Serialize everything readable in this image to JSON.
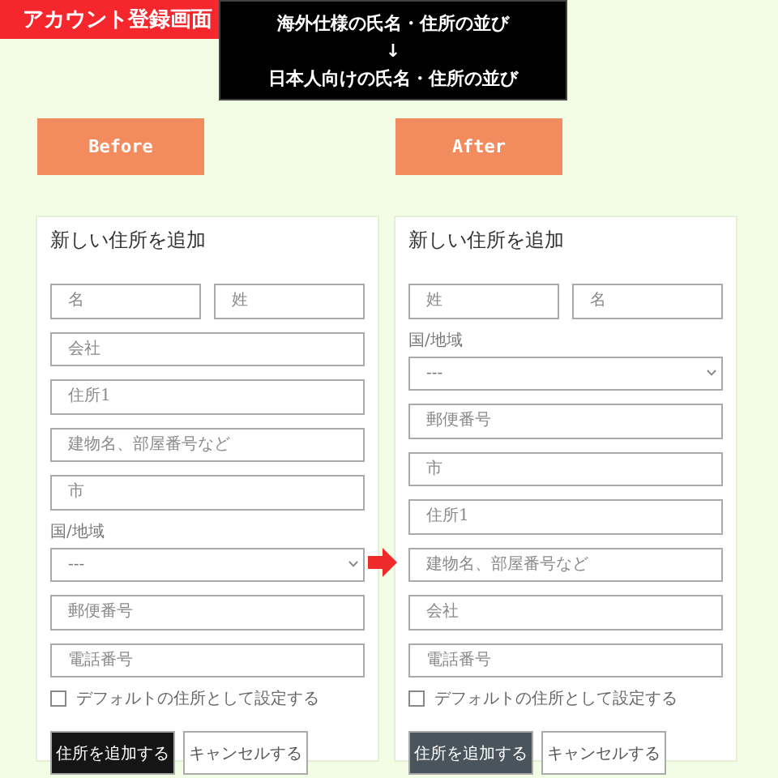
{
  "banner": {
    "title": "アカウント登録画面"
  },
  "caption": {
    "lines": [
      "海外仕様の氏名・住所の並び",
      "↓",
      "日本人向けの氏名・住所の並び"
    ]
  },
  "panels": [
    {
      "tag": "Before",
      "heading": "新しい住所を追加",
      "fields": [
        {
          "kind": "pair",
          "placeholders": [
            "名",
            "姓"
          ]
        },
        {
          "kind": "text",
          "placeholder": "会社"
        },
        {
          "kind": "text",
          "placeholder": "住所1"
        },
        {
          "kind": "text",
          "placeholder": "建物名、部屋番号など"
        },
        {
          "kind": "text",
          "placeholder": "市"
        },
        {
          "kind": "label",
          "text": "国/地域"
        },
        {
          "kind": "select",
          "value": "---"
        },
        {
          "kind": "text",
          "placeholder": "郵便番号"
        },
        {
          "kind": "text",
          "placeholder": "電話番号"
        }
      ],
      "checkbox": {
        "label": "デフォルトの住所として設定する",
        "checked": false
      },
      "buttons": [
        {
          "label": "住所を追加する",
          "kind": "primary",
          "color": "#151515"
        },
        {
          "label": "キャンセルする",
          "kind": "secondary",
          "color": "#ffffff"
        }
      ]
    },
    {
      "tag": "After",
      "heading": "新しい住所を追加",
      "fields": [
        {
          "kind": "pair",
          "placeholders": [
            "姓",
            "名"
          ]
        },
        {
          "kind": "label",
          "text": "国/地域"
        },
        {
          "kind": "select",
          "value": "---"
        },
        {
          "kind": "text",
          "placeholder": "郵便番号"
        },
        {
          "kind": "text",
          "placeholder": "市"
        },
        {
          "kind": "text",
          "placeholder": "住所1"
        },
        {
          "kind": "text",
          "placeholder": "建物名、部屋番号など"
        },
        {
          "kind": "text",
          "placeholder": "会社"
        },
        {
          "kind": "text",
          "placeholder": "電話番号"
        }
      ],
      "checkbox": {
        "label": "デフォルトの住所として設定する",
        "checked": false
      },
      "buttons": [
        {
          "label": "住所を追加する",
          "kind": "primary",
          "color": "#4a545c"
        },
        {
          "label": "キャンセルする",
          "kind": "secondary",
          "color": "#ffffff"
        }
      ]
    }
  ]
}
